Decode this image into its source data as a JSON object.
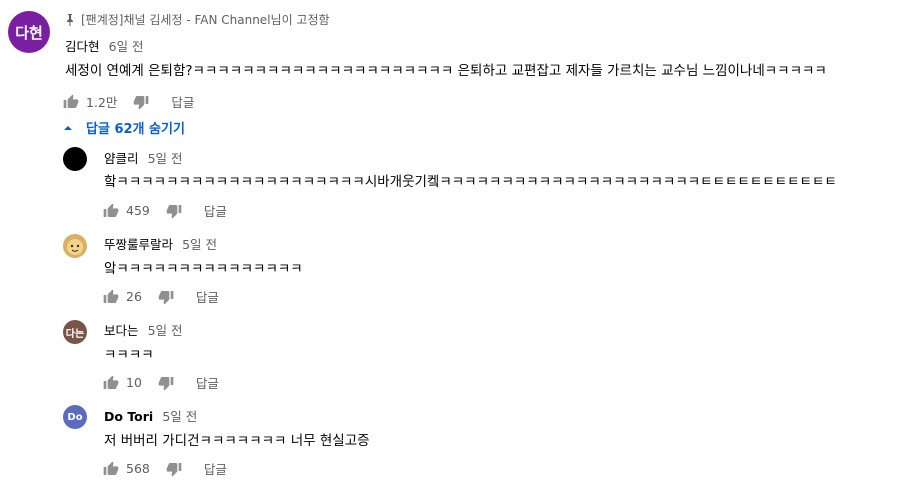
{
  "top_comment": {
    "avatar_text": "다현",
    "pinned_text": "[팬계정]채널 김세정 - FAN Channel님이 고정함",
    "author": "김다현",
    "time": "6일 전",
    "text": "세정이 연예계 은퇴함?ㅋㅋㅋㅋㅋㅋㅋㅋㅋㅋㅋㅋㅋㅋㅋㅋㅋㅋㅋㅋㅋ 은퇴하고 교편잡고 제자들 가르치는 교수님 느낌이나네ㅋㅋㅋㅋㅋ",
    "likes": "1.2만",
    "reply_label": "답글",
    "colors": {
      "avatar": "#7b1fa2"
    }
  },
  "replies_toggle": {
    "label": "답글 62개 숨기기"
  },
  "replies": [
    {
      "author": "얌클리",
      "time": "5일 전",
      "text": "핰ㅋㅋㅋㅋㅋㅋㅋㅋㅋㅋㅋㅋㅋㅋㅋㅋㅋㅋㅋㅋ시바개웃기켘ㅋㅋㅋㅋㅋㅋㅋㅋㅋㅋㅋㅋㅋㅋㅋㅋㅋㅋㅋㅋㅋㅌㅌㅌㅌㅌㅌㅌㅌㅌㅌㅌ",
      "likes": "459",
      "reply_label": "답글",
      "avatar": "black-circle"
    },
    {
      "author": "뚜짱룰루랄라",
      "time": "5일 전",
      "text": "앜ㅋㅋㅋㅋㅋㅋㅋㅋㅋㅋㅋㅋㅋㅋㅋ",
      "likes": "26",
      "reply_label": "답글",
      "avatar": "cartoon-face"
    },
    {
      "author": "보다는",
      "time": "5일 전",
      "text": "ㅋㅋㅋㅋ",
      "likes": "10",
      "reply_label": "답글",
      "avatar_text": "다는"
    },
    {
      "author": "Do Tori",
      "time": "5일 전",
      "text": "저 버버리 가디건ㅋㅋㅋㅋㅋㅋㅋ 너무 현실고증",
      "likes": "568",
      "reply_label": "답글",
      "avatar_text": "Do"
    }
  ]
}
